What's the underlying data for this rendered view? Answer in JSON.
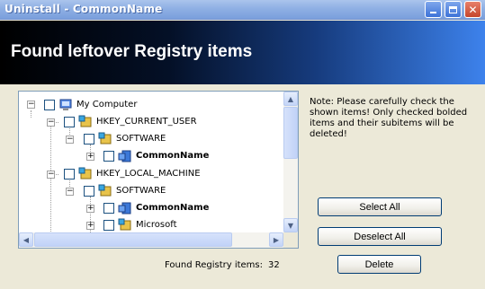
{
  "window": {
    "title": "Uninstall - CommonName",
    "min_glyph": "",
    "close_glyph": "✕"
  },
  "banner": {
    "title": "Found leftover Registry items"
  },
  "tree": {
    "nodes": [
      {
        "label": "My Computer",
        "bold": false,
        "icon": "computer-icon",
        "expander": "−"
      },
      {
        "label": "HKEY_CURRENT_USER",
        "bold": false,
        "icon": "registry-hive-icon",
        "expander": "−"
      },
      {
        "label": "SOFTWARE",
        "bold": false,
        "icon": "registry-folder-icon",
        "expander": "−"
      },
      {
        "label": "CommonName",
        "bold": true,
        "icon": "registry-key-icon",
        "expander": "+"
      },
      {
        "label": "HKEY_LOCAL_MACHINE",
        "bold": false,
        "icon": "registry-hive-icon",
        "expander": "−"
      },
      {
        "label": "SOFTWARE",
        "bold": false,
        "icon": "registry-folder-icon",
        "expander": "−"
      },
      {
        "label": "CommonName",
        "bold": true,
        "icon": "registry-key-icon",
        "expander": "+"
      },
      {
        "label": "Microsoft",
        "bold": false,
        "icon": "registry-folder-icon",
        "expander": "+"
      }
    ]
  },
  "note": "Note: Please carefully check the shown items! Only checked bolded items and their subitems will be deleted!",
  "buttons": {
    "select_all": "Select All",
    "deselect_all": "Deselect All",
    "delete": "Delete"
  },
  "status": {
    "label": "Found Registry items:",
    "count": "32"
  },
  "colors": {
    "titlebar": "#8fb0e4",
    "banner_start": "#000000",
    "banner_end": "#3d82ec",
    "window_bg": "#ece9d8"
  }
}
